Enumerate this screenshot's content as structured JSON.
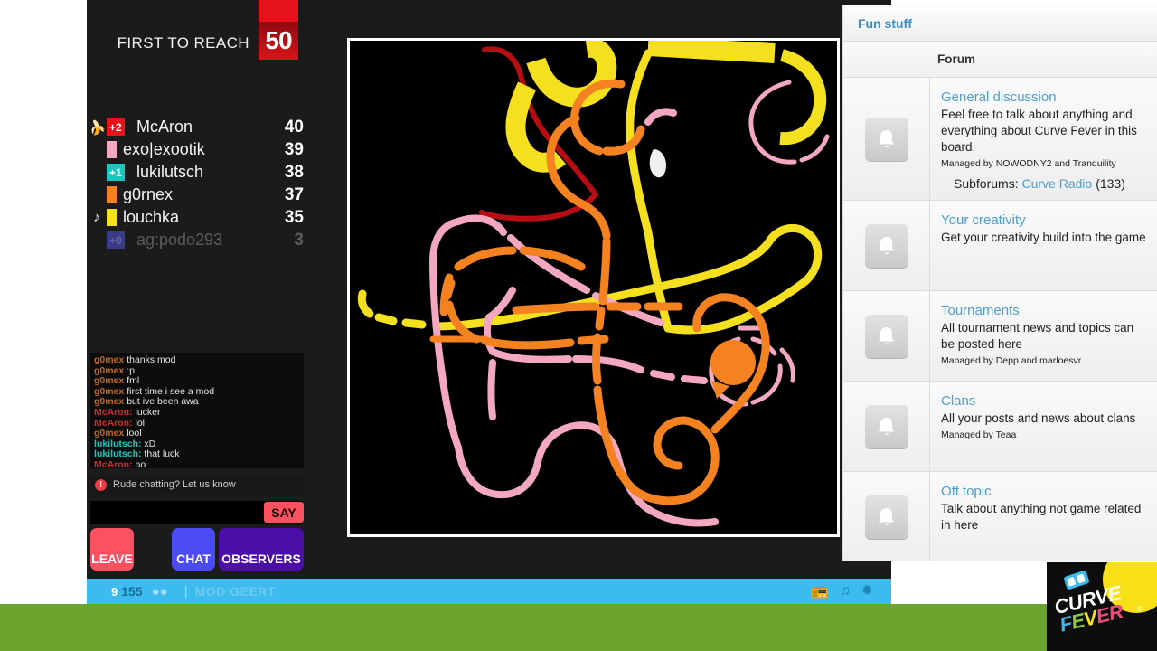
{
  "game": {
    "header": {
      "first_to_reach_label": "FIRST TO REACH",
      "target_score": "50"
    },
    "scoreboard": [
      {
        "icon": "banana-icon",
        "icon_glyph": "🍌",
        "color": "#e8131a",
        "delta": "+2",
        "name": "McAron",
        "score": "40",
        "dead": false
      },
      {
        "icon": "",
        "icon_glyph": "",
        "color": "#f4a8c0",
        "delta": "",
        "name": "exo|exootik",
        "score": "39",
        "dead": false
      },
      {
        "icon": "",
        "icon_glyph": "",
        "color": "#17c8c0",
        "delta": "+1",
        "name": "lukilutsch",
        "score": "38",
        "dead": false
      },
      {
        "icon": "",
        "icon_glyph": "",
        "color": "#f58220",
        "delta": "",
        "name": "g0rnex",
        "score": "37",
        "dead": false
      },
      {
        "icon": "music-note-icon",
        "icon_glyph": "♪",
        "color": "#f5e020",
        "delta": "",
        "name": "louchka",
        "score": "35",
        "dead": false
      },
      {
        "icon": "",
        "icon_glyph": "",
        "color": "#3a3a8a",
        "delta": "+0",
        "name": "ag:podo293",
        "score": "3",
        "dead": true
      }
    ],
    "chat": {
      "lines": [
        {
          "who": "g0mex",
          "who_color": "#c06a20",
          "text": "thanks mod"
        },
        {
          "who": "g0mex",
          "who_color": "#c06a20",
          "text": ":p"
        },
        {
          "who": "g0mex",
          "who_color": "#c06a20",
          "text": "fml"
        },
        {
          "who": "g0mex",
          "who_color": "#c06a20",
          "text": "first time i see a mod"
        },
        {
          "who": "g0mex",
          "who_color": "#c06a20",
          "text": "but ive been awa"
        },
        {
          "who": "McAron:",
          "who_color": "#d9262e",
          "text": "lucker"
        },
        {
          "who": "McAron:",
          "who_color": "#d9262e",
          "text": "lol"
        },
        {
          "who": "g0mex",
          "who_color": "#c06a20",
          "text": "lool"
        },
        {
          "who": "lukilutsch:",
          "who_color": "#17c8c0",
          "text": "xD"
        },
        {
          "who": "lukilutsch:",
          "who_color": "#17c8c0",
          "text": "that luck"
        },
        {
          "who": "McAron:",
          "who_color": "#d9262e",
          "text": "no"
        }
      ],
      "rude_warning": "Rude chatting? Let us know",
      "warning_glyph": "!",
      "input_value": "",
      "input_placeholder": "",
      "say_label": "SAY"
    },
    "buttons": {
      "leave": "LEAVE",
      "chat": "CHAT",
      "observers": "OBSERVERS"
    },
    "statusbar": {
      "level": "9",
      "xp": "155",
      "separator": "|",
      "username_prefix": "MOD",
      "username_bar": "|",
      "username_suffix": "GEERT",
      "icons": [
        {
          "name": "radio-icon",
          "glyph": "📻"
        },
        {
          "name": "music-icon",
          "glyph": "♫"
        },
        {
          "name": "effects-icon",
          "glyph": "✹"
        }
      ]
    }
  },
  "forum": {
    "panel_title": "Fun stuff",
    "column_header": "Forum",
    "rows": [
      {
        "icon": "bell-icon",
        "title": "General discussion",
        "description": "Feel free to talk about anything and everything about Curve Fever in this board.",
        "managed_by": "Managed by NOWODNY2 and Tranquility",
        "subforums_label": "Subforums:",
        "subforum_link": "Curve Radio",
        "subforum_count": "(133)"
      },
      {
        "icon": "bell-icon",
        "title": "Your creativity",
        "description": "Get your creativity build into the game",
        "managed_by": "",
        "subforums_label": "",
        "subforum_link": "",
        "subforum_count": ""
      },
      {
        "icon": "bell-icon",
        "title": "Tournaments",
        "description": "All tournament news and topics can be posted here",
        "managed_by": "Managed by Depp and marloesvr",
        "subforums_label": "",
        "subforum_link": "",
        "subforum_count": ""
      },
      {
        "icon": "bell-icon",
        "title": "Clans",
        "description": "All your posts and news about clans",
        "managed_by": "Managed by Teaa",
        "subforums_label": "",
        "subforum_link": "",
        "subforum_count": ""
      },
      {
        "icon": "bell-icon",
        "title": "Off topic",
        "description": "Talk about anything not game related in here",
        "managed_by": "",
        "subforums_label": "",
        "subforum_link": "",
        "subforum_count": ""
      }
    ]
  },
  "logo": {
    "word1": "CURVE",
    "word2": "FEVER",
    "registered": "©"
  },
  "board": {
    "background": "#000000",
    "border_color": "#ffffff",
    "trails": [
      {
        "player": "McAron",
        "color": "#b80d13"
      },
      {
        "player": "exo|exootik",
        "color": "#f4a8c0"
      },
      {
        "player": "lukilutsch",
        "color": "#17c8c0"
      },
      {
        "player": "g0rnex",
        "color": "#f58220"
      },
      {
        "player": "louchka",
        "color": "#f5e020"
      }
    ]
  },
  "colors": {
    "accent_blue": "#3bbbef",
    "grass_green": "#6aa32e",
    "game_bg": "#1b1b1b",
    "red": "#e8131a",
    "forum_link": "#4e9ecd"
  }
}
